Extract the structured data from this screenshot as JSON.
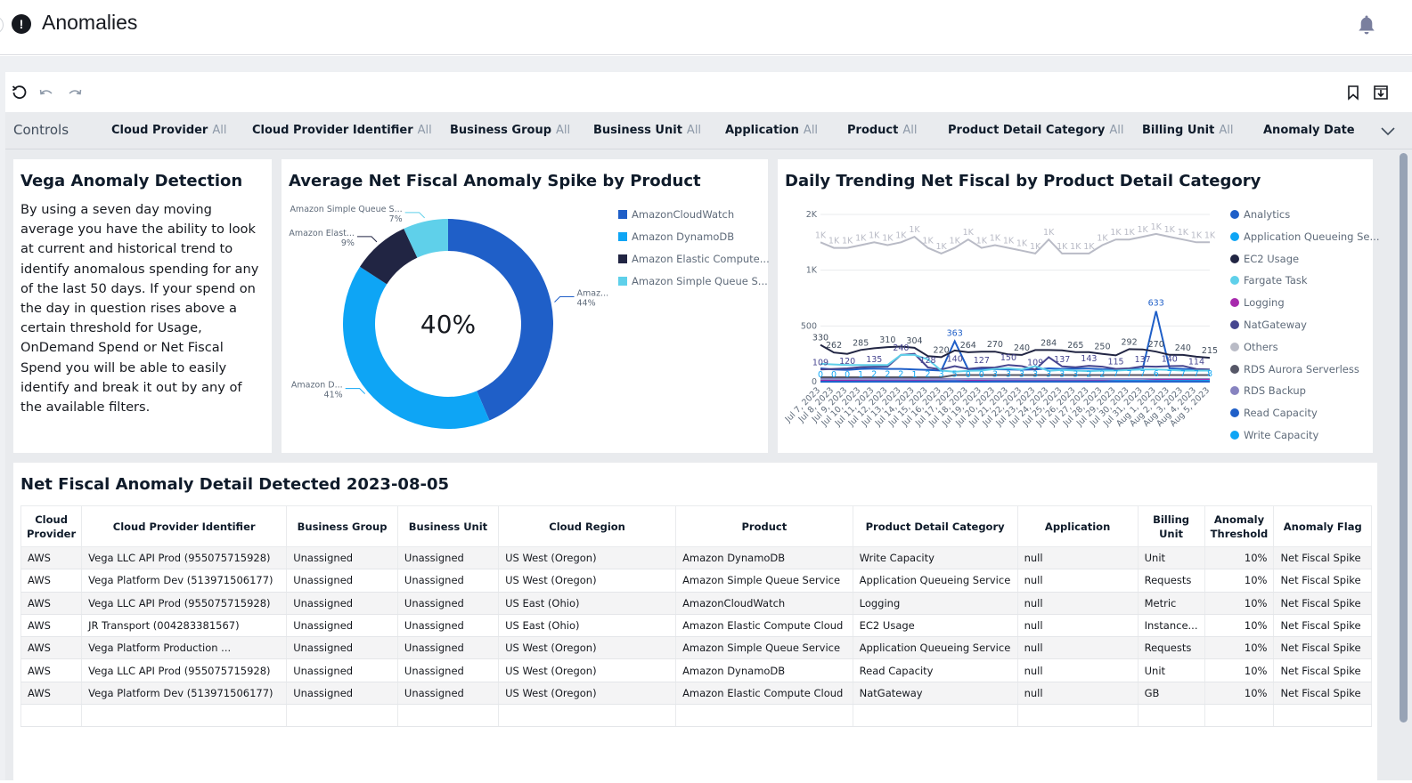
{
  "header": {
    "title": "Anomalies",
    "icon": "alert-circle-icon",
    "notification_icon": "bell-icon"
  },
  "toolbar": {
    "icons": [
      "reset-icon",
      "undo-icon",
      "redo-icon",
      "bookmark-icon",
      "export-icon"
    ]
  },
  "controls": {
    "label": "Controls",
    "filters": [
      {
        "name": "Cloud Provider",
        "value": "All"
      },
      {
        "name": "Cloud Provider Identifier",
        "value": "All"
      },
      {
        "name": "Business Group",
        "value": "All"
      },
      {
        "name": "Business Unit",
        "value": "All"
      },
      {
        "name": "Application",
        "value": "All"
      },
      {
        "name": "Product",
        "value": "All"
      },
      {
        "name": "Product Detail Category",
        "value": "All"
      },
      {
        "name": "Billing Unit",
        "value": "All"
      },
      {
        "name": "Anomaly Date",
        "value": ""
      }
    ]
  },
  "info_card": {
    "title": "Vega Anomaly Detection",
    "text": "By using a seven day moving average you have the ability to look at current and historical trend to identify anomalous spending for any of the last 50 days. If your spend on the day in question rises above a certain threshold for Usage, OnDemand Spend or Net Fiscal Spend you will be able to easily identify and break it out by any of the available filters."
  },
  "chart_data": [
    {
      "type": "pie",
      "variant": "donut",
      "title": "Average Net Fiscal Anomaly Spike by Product",
      "center_label": "40%",
      "legend_position": "right",
      "slices": [
        {
          "label": "AmazonCloudWatch",
          "short_label": "Amaz...",
          "value": 44,
          "color": "#1f5fc8"
        },
        {
          "label": "Amazon DynamoDB",
          "short_label": "Amazon D...",
          "value": 41,
          "color": "#0ea5f5"
        },
        {
          "label": "Amazon Elastic Compute...",
          "short_label": "Amazon Elast...",
          "value": 9,
          "color": "#212543"
        },
        {
          "label": "Amazon Simple Queue S...",
          "short_label": "Amazon Simple Queue S...",
          "value": 7,
          "color": "#5fd0ea"
        }
      ]
    },
    {
      "type": "line",
      "title": "Daily Trending Net Fiscal by Product Detail Category",
      "xlabel": "",
      "ylabel": "",
      "y_ticks": [
        0,
        500,
        1000,
        2000
      ],
      "y_tick_labels": [
        "0",
        "500",
        "1K",
        "2K"
      ],
      "y_scale": "log-like",
      "ylim": [
        0,
        2000
      ],
      "grid": true,
      "legend_position": "right",
      "x": [
        "Jul 7, 2023",
        "Jul 8, 2023",
        "Jul 9, 2023",
        "Jul 10, 2023",
        "Jul 11, 2023",
        "Jul 12, 2023",
        "Jul 13, 2023",
        "Jul 14, 2023",
        "Jul 15, 2023",
        "Jul 16, 2023",
        "Jul 17, 2023",
        "Jul 18, 2023",
        "Jul 19, 2023",
        "Jul 20, 2023",
        "Jul 21, 2023",
        "Jul 22, 2023",
        "Jul 23, 2023",
        "Jul 24, 2023",
        "Jul 25, 2023",
        "Jul 26, 2023",
        "Jul 27, 2023",
        "Jul 28, 2023",
        "Jul 29, 2023",
        "Jul 30, 2023",
        "Jul 31, 2023",
        "Aug 1, 2023",
        "Aug 2, 2023",
        "Aug 3, 2023",
        "Aug 4, 2023",
        "Aug 5, 2023"
      ],
      "series": [
        {
          "name": "Analytics",
          "color": "#1f5fc8",
          "values": [
            1,
            1,
            1,
            1,
            1,
            1,
            1,
            1,
            1,
            1,
            1,
            1,
            1,
            1,
            1,
            1,
            1,
            1,
            1,
            1,
            1,
            1,
            1,
            1,
            1,
            1,
            1,
            1,
            1,
            1
          ]
        },
        {
          "name": "Application Queueing Se...",
          "color": "#0ea5f5",
          "values": [
            0,
            0,
            0,
            1,
            2,
            2,
            2,
            1,
            2,
            3,
            5,
            0,
            0,
            3,
            3,
            3,
            3,
            3,
            3,
            3,
            2,
            2,
            7,
            7,
            7,
            6,
            7,
            7,
            7,
            8
          ],
          "labels": true
        },
        {
          "name": "EC2 Usage",
          "color": "#212543",
          "values": [
            330,
            262,
            250,
            285,
            300,
            310,
            315,
            304,
            230,
            220,
            280,
            264,
            269,
            270,
            245,
            240,
            284,
            284,
            282,
            265,
            265,
            250,
            236,
            292,
            290,
            270,
            241,
            240,
            224,
            215
          ],
          "labels": true
        },
        {
          "name": "Fargate Task",
          "color": "#5fd0ea",
          "values": [
            160,
            155,
            150,
            150,
            150,
            150,
            240,
            240,
            200,
            100,
            90,
            98,
            100,
            115,
            120,
            110,
            140,
            98,
            105,
            100,
            95,
            100,
            100,
            105,
            110,
            110,
            105,
            100,
            100,
            100
          ]
        },
        {
          "name": "Logging",
          "color": "#a729ad",
          "values": [
            8,
            8,
            8,
            8,
            8,
            8,
            8,
            8,
            8,
            8,
            8,
            8,
            8,
            8,
            8,
            8,
            8,
            8,
            8,
            8,
            8,
            8,
            8,
            8,
            8,
            15,
            15,
            15,
            15,
            15
          ]
        },
        {
          "name": "NatGateway",
          "color": "#46458f",
          "values": [
            109,
            115,
            120,
            131,
            135,
            136,
            240,
            250,
            128,
            110,
            140,
            115,
            127,
            128,
            150,
            140,
            109,
            220,
            137,
            130,
            143,
            135,
            115,
            120,
            137,
            135,
            140,
            142,
            114,
            110
          ],
          "labels": true
        },
        {
          "name": "Others",
          "color": "#b9bbc6",
          "values": [
            1500,
            1400,
            1400,
            1450,
            1500,
            1450,
            1500,
            1600,
            1400,
            1300,
            1400,
            1550,
            1400,
            1450,
            1400,
            1350,
            1300,
            1550,
            1300,
            1300,
            1300,
            1450,
            1550,
            1550,
            1600,
            1650,
            1600,
            1550,
            1500,
            1500
          ],
          "labels": true,
          "label_text": "1K"
        },
        {
          "name": "RDS Aurora Serverless",
          "color": "#565767",
          "values": [
            40,
            40,
            40,
            40,
            40,
            40,
            40,
            40,
            40,
            40,
            60,
            60,
            60,
            60,
            60,
            60,
            60,
            60,
            60,
            60,
            60,
            60,
            60,
            60,
            60,
            60,
            60,
            60,
            60,
            60
          ]
        },
        {
          "name": "RDS Backup",
          "color": "#8783c0",
          "values": [
            25,
            25,
            25,
            25,
            25,
            25,
            25,
            25,
            25,
            25,
            25,
            25,
            25,
            25,
            25,
            25,
            25,
            25,
            25,
            25,
            25,
            25,
            25,
            25,
            25,
            25,
            25,
            25,
            25,
            25
          ]
        },
        {
          "name": "Read Capacity",
          "color": "#1f5fc8",
          "values": [
            120,
            110,
            105,
            115,
            118,
            115,
            115,
            110,
            105,
            100,
            363,
            110,
            115,
            112,
            110,
            108,
            110,
            120,
            115,
            117,
            118,
            112,
            110,
            115,
            115,
            633,
            120,
            115,
            110,
            108
          ],
          "peak_labels": {
            "10": 363,
            "25": 633
          }
        },
        {
          "name": "Write Capacity",
          "color": "#0ea5f5",
          "values": [
            3,
            3,
            3,
            3,
            3,
            3,
            3,
            3,
            3,
            3,
            3,
            3,
            3,
            3,
            3,
            3,
            3,
            3,
            3,
            3,
            3,
            3,
            3,
            3,
            3,
            3,
            3,
            3,
            3,
            3
          ]
        }
      ]
    }
  ],
  "table": {
    "title": "Net Fiscal Anomaly Detail Detected 2023-08-05",
    "columns": [
      "Cloud Provider",
      "Cloud Provider Identifier",
      "Business Group",
      "Business Unit",
      "Cloud Region",
      "Product",
      "Product Detail Category",
      "Application",
      "Billing Unit",
      "Anomaly Threshold",
      "Anomaly Flag"
    ],
    "rows": [
      [
        "AWS",
        "Vega LLC API Prod (955075715928)",
        "Unassigned",
        "Unassigned",
        "US West (Oregon)",
        "Amazon DynamoDB",
        "Write Capacity",
        "null",
        "Unit",
        "10%",
        "Net Fiscal Spike"
      ],
      [
        "AWS",
        "Vega Platform Dev (513971506177)",
        "Unassigned",
        "Unassigned",
        "US West (Oregon)",
        "Amazon Simple Queue Service",
        "Application Queueing Service",
        "null",
        "Requests",
        "10%",
        "Net Fiscal Spike"
      ],
      [
        "AWS",
        "Vega LLC API Prod (955075715928)",
        "Unassigned",
        "Unassigned",
        "US East (Ohio)",
        "AmazonCloudWatch",
        "Logging",
        "null",
        "Metric",
        "10%",
        "Net Fiscal Spike"
      ],
      [
        "AWS",
        "JR Transport (004283381567)",
        "Unassigned",
        "Unassigned",
        "US East (Ohio)",
        "Amazon Elastic Compute Cloud",
        "EC2 Usage",
        "null",
        "Instance...",
        "10%",
        "Net Fiscal Spike"
      ],
      [
        "AWS",
        "Vega Platform Production ...",
        "Unassigned",
        "Unassigned",
        "US West (Oregon)",
        "Amazon Simple Queue Service",
        "Application Queueing Service",
        "null",
        "Requests",
        "10%",
        "Net Fiscal Spike"
      ],
      [
        "AWS",
        "Vega LLC API Prod (955075715928)",
        "Unassigned",
        "Unassigned",
        "US West (Oregon)",
        "Amazon DynamoDB",
        "Read Capacity",
        "null",
        "Unit",
        "10%",
        "Net Fiscal Spike"
      ],
      [
        "AWS",
        "Vega Platform Dev (513971506177)",
        "Unassigned",
        "Unassigned",
        "US West (Oregon)",
        "Amazon Elastic Compute Cloud",
        "NatGateway",
        "null",
        "GB",
        "10%",
        "Net Fiscal Spike"
      ]
    ]
  }
}
